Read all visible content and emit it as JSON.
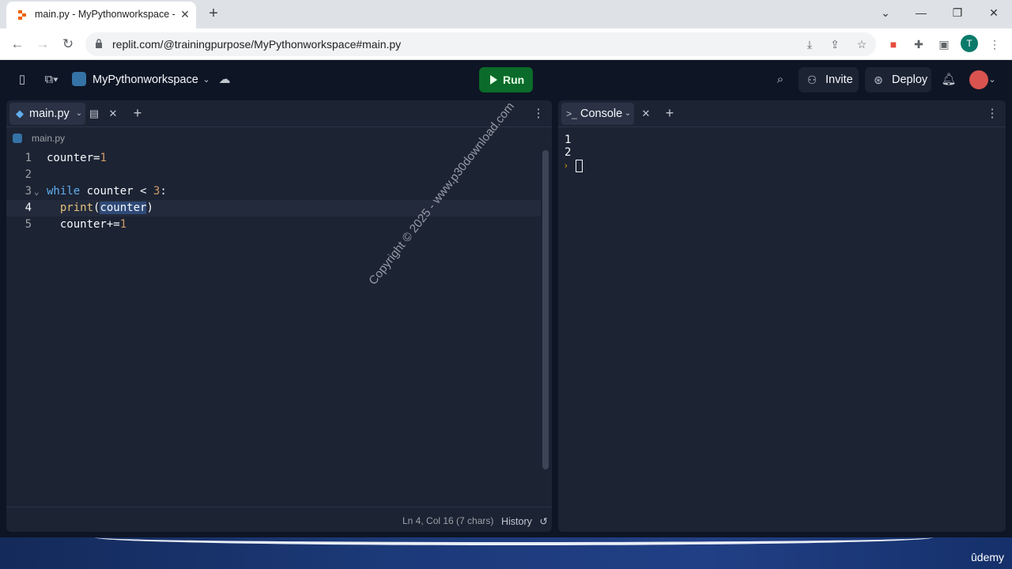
{
  "browser": {
    "tab_title": "main.py - MyPythonworkspace -",
    "url": "replit.com/@trainingpurpose/MyPythonworkspace#main.py",
    "profile_initial": "T"
  },
  "header": {
    "repl_name": "MyPythonworkspace",
    "run_label": "Run",
    "invite_label": "Invite",
    "deploy_label": "Deploy"
  },
  "editor": {
    "tab_label": "main.py",
    "breadcrumb": "main.py",
    "lines": [
      {
        "n": "1",
        "text": "counter=1"
      },
      {
        "n": "2",
        "text": ""
      },
      {
        "n": "3",
        "text": "while counter < 3:"
      },
      {
        "n": "4",
        "text": "  print(counter)"
      },
      {
        "n": "5",
        "text": "  counter+=1"
      }
    ],
    "status_position": "Ln 4, Col 16 (7 chars)",
    "history_label": "History"
  },
  "console": {
    "tab_label": "Console",
    "output": [
      "1",
      "2"
    ]
  },
  "watermark": "Copyright © 2025 - www.p30download.com",
  "footer": {
    "brand": "ûdemy"
  },
  "colors": {
    "run_green": "#0b6b2a",
    "panel_bg": "#1c2333",
    "app_bg": "#0e1525"
  }
}
